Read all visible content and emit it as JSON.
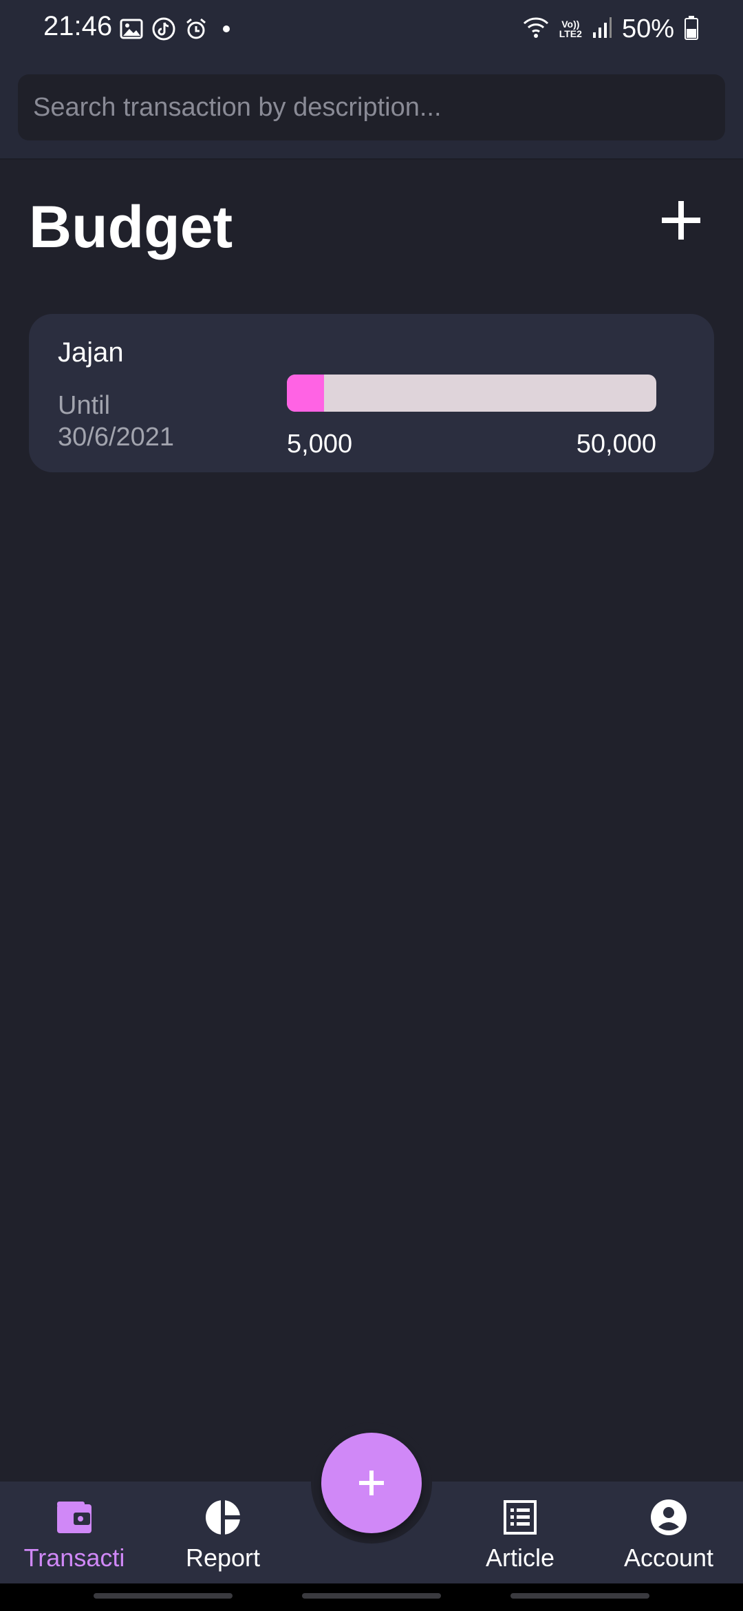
{
  "status_bar": {
    "time": "21:46",
    "battery": "50%",
    "network_badge_top": "Vo))",
    "network_badge_bottom": "LTE2",
    "icons": [
      "gallery-icon",
      "tiktok-icon",
      "alarm-icon",
      "dot-icon",
      "wifi-icon",
      "signal-icon",
      "battery-icon"
    ]
  },
  "search": {
    "placeholder": "Search transaction by description..."
  },
  "header": {
    "title": "Budget",
    "add_icon": "plus-icon"
  },
  "budgets": [
    {
      "name": "Jajan",
      "until_label": "Until",
      "until_date": "30/6/2021",
      "spent": "5,000",
      "limit": "50,000",
      "progress_fraction": 0.1
    }
  ],
  "bottom_nav": {
    "items": [
      {
        "label": "Transacti",
        "icon": "wallet-icon",
        "active": true
      },
      {
        "label": "Report",
        "icon": "pie-chart-icon",
        "active": false
      },
      {
        "label": "Article",
        "icon": "article-icon",
        "active": false
      },
      {
        "label": "Account",
        "icon": "account-icon",
        "active": false
      }
    ],
    "fab_icon": "plus-icon"
  },
  "colors": {
    "background": "#20212b",
    "surface": "#2b2e3f",
    "accent": "#d088f7",
    "progress_fill": "#ff63e4",
    "progress_track": "#dfd4da"
  }
}
